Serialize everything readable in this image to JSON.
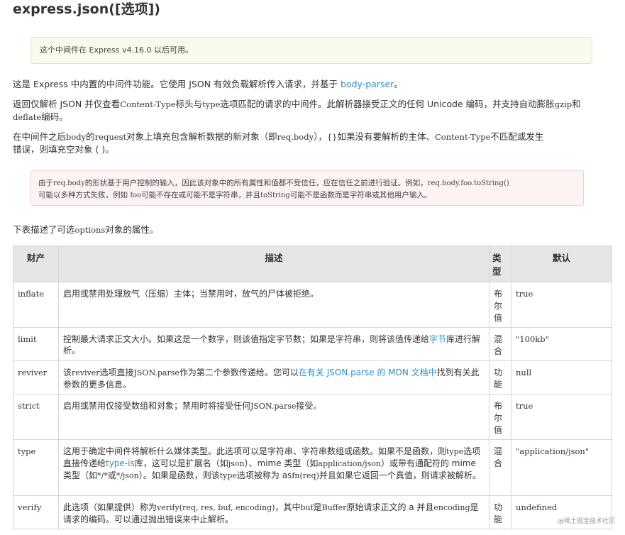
{
  "title": "express.json([选项])",
  "note": "这个中间件在 Express v4.16.0 以后可用。",
  "intro": {
    "text": "这是 Express 中内置的中间件功能。它使用 JSON 有效负载解析传入请求，并基于 ",
    "link": "body-parser",
    "end": "。"
  },
  "p2": {
    "a": "返回仅解析 JSON 并仅查看",
    "code1": "Content-Type",
    "b": "标头与",
    "code2": "type",
    "c": "选项匹配的请求的中间件。此解析器接受正文的任何 Unicode 编码，并支持自动膨胀",
    "code3": "gzip",
    "d": "和 ",
    "code4": "deflate",
    "e": "编码。"
  },
  "p3": {
    "code1": "body",
    "a": "在中间件之后",
    "b": "的",
    "code2": "request",
    "c": "对象上填充包含解析数据的新对象（即",
    "code3": "req.body",
    "d": "），",
    "code4": "{}",
    "e": "如果没有要解析的主体、",
    "code5": "Content-Type",
    "f": "不匹配或发生",
    "line2": "错误，则填充空对象 ( )。"
  },
  "warning": {
    "a": "由于",
    "code1": "req.body",
    "b": "的形状基于用户控制的输入，因此该对象中的所有属性和值都不受信任，应在信任之前进行验证。例如，",
    "code2": "req.body.foo.toString()",
    "c": "可能以多种方式失败，例如 ",
    "code3": "foo",
    "d": "可能不存在或可能不是字符串，并且",
    "code4": "toString",
    "e": "可能不是函数而是字符串或其他用户输入。"
  },
  "table_intro": {
    "a": "下表描述了可选",
    "code": "options",
    "b": "对象的属性。"
  },
  "table": {
    "headers": [
      "财产",
      "描述",
      "类型",
      "默认"
    ],
    "rows": [
      {
        "prop": "inflate",
        "desc": "启用或禁用处理放气（压缩）主体；当禁用时，放气的尸体被拒绝。",
        "type": "布尔值",
        "default": "true"
      },
      {
        "prop": "limit",
        "desc_a": "控制最大请求正文大小。如果这是一个数字，则该值指定字节数；如果是字符串，则将该值传递给",
        "desc_link": "字节",
        "desc_b": "库进行解析。",
        "type": "混合",
        "default": "\"100kb\""
      },
      {
        "prop": "reviver",
        "desc_a": "该",
        "desc_code1": "reviver",
        "desc_b": "选项直接",
        "desc_code2": "JSON.parse",
        "desc_c": "作为第二个参数传递给。您可以",
        "desc_link": "在有关 JSON.parse 的 MDN 文档中",
        "desc_d": "找到有关此参数的更多信息。",
        "type": "功能",
        "default": "null"
      },
      {
        "prop": "strict",
        "desc_a": "启用或禁用仅接受数组和对象；禁用时将接受任何",
        "desc_code": "JSON.parse",
        "desc_b": "接受。",
        "type": "布尔值",
        "default": "true"
      },
      {
        "prop": "type",
        "desc_a": "这用于确定中间件将解析什么媒体类型。此选项可以是字符串、字符串数组或函数。如果不是函数，则",
        "desc_code1": "type",
        "desc_b": "选项直接传递给",
        "desc_link": "type-is",
        "desc_c": "库，这可以是扩展名（如",
        "desc_code2": "json",
        "desc_d": "）、mime 类型（如",
        "desc_code3": "application/json",
        "desc_e": "）或带有通配符的 mime 类型（如",
        "desc_code4": "*/*",
        "desc_f": "或",
        "desc_code5": "*/json",
        "desc_g": "）。如果是函数，则该",
        "desc_code6": "type",
        "desc_h": "选项被称为 as",
        "desc_code7": "fn(req)",
        "desc_i": "并且如果它返回一个真值，则请求被解析。",
        "type": "混合",
        "default": "\"application/json\""
      },
      {
        "prop": "verify",
        "desc_a": "此选项（如果提供）称为",
        "desc_code1": "verify(req, res, buf, encoding)",
        "desc_b": "，其中",
        "desc_code2": "buf",
        "desc_c": "是",
        "desc_code3": "Buffer",
        "desc_d": "原始请求正文的 a 并且",
        "desc_code4": "encoding",
        "desc_e": "是请求的编码。可以通过抛出错误来中止解析。",
        "type": "功能",
        "default": "undefined"
      }
    ]
  },
  "watermark": "@稀土掘金技术社区"
}
